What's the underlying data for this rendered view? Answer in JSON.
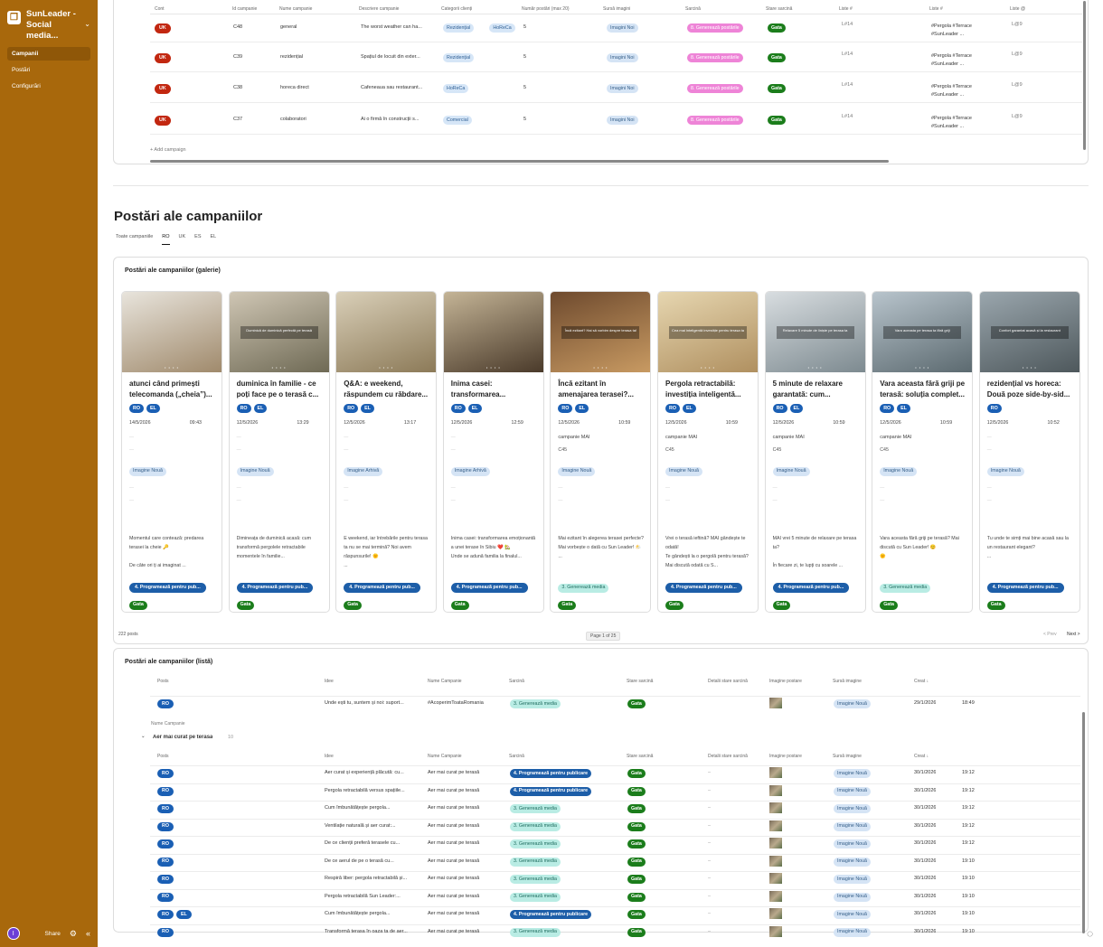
{
  "sidebar": {
    "title": "SunLeader - Social media...",
    "items": [
      {
        "label": "Campanii",
        "active": true
      },
      {
        "label": "Postări",
        "active": false
      },
      {
        "label": "Configurări",
        "active": false
      }
    ],
    "avatar": "I",
    "share": "Share"
  },
  "campaigns_table": {
    "headers": [
      "Cont",
      "Id campanie",
      "Nume campanie",
      "Descriere campanie",
      "Categorii clienți",
      "Număr postări (max 20)",
      "Sursă imagini",
      "Sarcină",
      "Stare sarcină",
      "Liste #",
      "Liste #",
      "Liste @"
    ],
    "rows": [
      {
        "cont": "UK",
        "id": "C48",
        "name": "general",
        "desc": "The worst weather can ha...",
        "cats": [
          "Rezidențial",
          "HoReCa"
        ],
        "count": "5",
        "source": "Imagini Noi",
        "task": "8. Generează postările",
        "state": "Gata",
        "list1": "L#14",
        "tags1": "#Pergola #Terrace",
        "tags2": "#SunLeader ...",
        "list3": "L@9"
      },
      {
        "cont": "UK",
        "id": "C39",
        "name": "rezidențial",
        "desc": "Spațiul de locuit din exter...",
        "cats": [
          "Rezidențial"
        ],
        "count": "5",
        "source": "Imagini Noi",
        "task": "8. Generează postările",
        "state": "Gata",
        "list1": "L#14",
        "tags1": "#Pergola #Terrace",
        "tags2": "#SunLeader ...",
        "list3": "L@9"
      },
      {
        "cont": "UK",
        "id": "C38",
        "name": "horeca direct",
        "desc": "Cafeneaua sau restaurant...",
        "cats": [
          "HoReCa"
        ],
        "count": "5",
        "source": "Imagini Noi",
        "task": "8. Generează postările",
        "state": "Gata",
        "list1": "L#14",
        "tags1": "#Pergola #Terrace",
        "tags2": "#SunLeader ...",
        "list3": "L@9"
      },
      {
        "cont": "UK",
        "id": "C37",
        "name": "colaboratori",
        "desc": "Ai o firmă în construcții s...",
        "cats": [
          "Comercial"
        ],
        "count": "5",
        "source": "Imagini Noi",
        "task": "8. Generează postările",
        "state": "Gata",
        "list1": "L#14",
        "tags1": "#Pergola #Terrace",
        "tags2": "#SunLeader ...",
        "list3": "L@9"
      }
    ],
    "add_label": "+ Add campaign"
  },
  "posts_section": {
    "title": "Postări ale campaniilor",
    "tabs": [
      "Toate campaniile",
      "RO",
      "UK",
      "ES",
      "EL"
    ],
    "active_tab": "RO"
  },
  "gallery": {
    "title": "Postări ale campaniilor (galerie)",
    "cards": [
      {
        "title": "atunci când primești telecomanda („cheia”)...",
        "langs": [
          "RO",
          "EL"
        ],
        "date": "14/5/2026",
        "time": "09:43",
        "campaign": "",
        "cid": "",
        "img": "Imagine Nouă",
        "idea": "Momentul care contează: predarea terasei la cheie 🔑\n\nDe câte ori ți ai imaginat ...",
        "task": "4. Programează pentru pub...",
        "task_kind": "dark",
        "state": "Gata",
        "overlay": "",
        "colors": [
          "#e8e4dc",
          "#a08a6c"
        ]
      },
      {
        "title": "duminica în familie - ce poți face pe o terasă c...",
        "langs": [
          "RO",
          "EL"
        ],
        "date": "12/5/2026",
        "time": "13:29",
        "campaign": "",
        "cid": "",
        "img": "Imagine Nouă",
        "idea": "Dimineața de duminică acasă: cum transformă pergolele retractabile momentele în familie...",
        "task": "4. Programează pentru pub...",
        "task_kind": "dark",
        "state": "Gata",
        "overlay": "Duminică de duminică perfectă pe terasă",
        "colors": [
          "#cfc6b4",
          "#6f6a55"
        ]
      },
      {
        "title": "Q&A: e weekend, răspundem cu răbdare...",
        "langs": [
          "RO",
          "EL"
        ],
        "date": "12/5/2026",
        "time": "13:17",
        "campaign": "",
        "cid": "",
        "img": "Imagine Arhivă",
        "idea": "E weekend, iar întrebările pentru terasa ta nu se mai termină? Noi avem răspunsurile! 🌞\n...",
        "task": "4. Programează pentru pub...",
        "task_kind": "dark",
        "state": "Gata",
        "overlay": "",
        "colors": [
          "#d9cfb8",
          "#8c7a58"
        ]
      },
      {
        "title": "Inima casei: transformarea...",
        "langs": [
          "RO",
          "EL"
        ],
        "date": "12/5/2026",
        "time": "12:59",
        "campaign": "",
        "cid": "",
        "img": "Imagine Arhivă",
        "idea": "Inima casei: transformarea emoționantă a unei terase în Sibiu ❤️ 🏡\nUnde se adună familia la finalul...",
        "task": "4. Programează pentru pub...",
        "task_kind": "dark",
        "state": "Gata",
        "overlay": "",
        "colors": [
          "#c4b496",
          "#4a3a2a"
        ]
      },
      {
        "title": "Încă ezitant în amenajarea terasei?...",
        "langs": [
          "RO",
          "EL"
        ],
        "date": "12/5/2026",
        "time": "10:59",
        "campaign": "campanie MAI",
        "cid": "C45",
        "img": "Imagine Nouă",
        "idea": "Mai ezitant în alegerea terasei perfecte? Mai vorbește o dată cu Sun Leader! 🌤️\n...",
        "task": "3. Generează media",
        "task_kind": "teal",
        "state": "Gata",
        "overlay": "Încă ezitant? Hai să vorbim despre terasa ta!",
        "colors": [
          "#6e4a2e",
          "#c89a62"
        ]
      },
      {
        "title": "Pergola retractabilă: investiția inteligentă...",
        "langs": [
          "RO",
          "EL"
        ],
        "date": "12/5/2026",
        "time": "10:59",
        "campaign": "campanie MAI",
        "cid": "C45",
        "img": "Imagine Nouă",
        "idea": "Vrei o terasă ieftină? MAI gândește te odată!\nTe gândești la o pergolă pentru terasă? Mai discută odată cu S...",
        "task": "4. Programează pentru pub...",
        "task_kind": "dark",
        "state": "Gata",
        "overlay": "Cea mai inteligentă investiție pentru terasa ta",
        "colors": [
          "#e6d6b0",
          "#b09060"
        ]
      },
      {
        "title": "5 minute de relaxare garantată: cum...",
        "langs": [
          "RO",
          "EL"
        ],
        "date": "12/5/2026",
        "time": "10:59",
        "campaign": "campanie MAI",
        "cid": "C45",
        "img": "Imagine Nouă",
        "idea": "MAI vrei 5 minute de relaxare pe terasa ta?\n\nÎn fiecare zi, te lupți cu soarele ...",
        "task": "4. Programează pentru pub...",
        "task_kind": "dark",
        "state": "Gata",
        "overlay": "Relaxare 5 minute de liniște pe terasa ta",
        "colors": [
          "#d8dde0",
          "#7d8a90"
        ]
      },
      {
        "title": "Vara aceasta fără griji pe terasă: soluția complet...",
        "langs": [
          "RO",
          "EL"
        ],
        "date": "12/5/2026",
        "time": "10:59",
        "campaign": "campanie MAI",
        "cid": "C45",
        "img": "Imagine Nouă",
        "idea": "Vara aceasta fără griji pe terasă? Mai discută cu Sun Leader! 😊\n🌞",
        "task": "3. Generează media",
        "task_kind": "teal",
        "state": "Gata",
        "overlay": "Vara aceasta pe terasa ta fără griji",
        "colors": [
          "#b8c4cc",
          "#5c6a70"
        ]
      },
      {
        "title": "rezidențial vs horeca: Două poze side-by-sid...",
        "langs": [
          "RO"
        ],
        "date": "12/5/2026",
        "time": "10:52",
        "campaign": "",
        "cid": "",
        "img": "Imagine Nouă",
        "idea": "Tu unde te simți mai bine acasă sau la un restaurant elegant?\n...",
        "task": "4. Programează pentru pub...",
        "task_kind": "dark",
        "state": "Gata",
        "overlay": "Confort garantat acasă și la restaurant",
        "colors": [
          "#9aa6ad",
          "#4e585c"
        ]
      }
    ],
    "count": "222 posts",
    "page": "Page 1 of 25",
    "prev": "< Prev",
    "next": "Next >"
  },
  "list": {
    "title": "Postări ale campaniilor (listă)",
    "headers": [
      "Posts",
      "Idee",
      "Nume Campanie",
      "Sarcină",
      "Stare sarcină",
      "Detalii stare sarcină",
      "Imagine postare",
      "Sursă imagine",
      "Creat ↓"
    ],
    "top_row": {
      "langs": [
        "RO"
      ],
      "idea": "Unde ești tu, suntem și noi: suport...",
      "campaign": "#AcoperimToataRomania",
      "task": "3. Generează media",
      "task_kind": "teal",
      "state": "Gata",
      "detail": "",
      "img": "Imagine Nouă",
      "date": "29/1/2026",
      "time": "18:49"
    },
    "group_label": "Nume Campanie",
    "group_name": "Aer mai curat pe terasă",
    "group_count": "10",
    "rows": [
      {
        "langs": [
          "RO"
        ],
        "idea": "Aer curat și experiență plăcută: cu...",
        "campaign": "Aer mai curat pe terasă",
        "task": "4. Programează pentru publicare",
        "task_kind": "dark",
        "state": "Gata",
        "detail": "–",
        "img": "Imagine Nouă",
        "date": "30/1/2026",
        "time": "19:12"
      },
      {
        "langs": [
          "RO"
        ],
        "idea": "Pergola retractabilă versus spațiile...",
        "campaign": "Aer mai curat pe terasă",
        "task": "4. Programează pentru publicare",
        "task_kind": "dark",
        "state": "Gata",
        "detail": "–",
        "img": "Imagine Nouă",
        "date": "30/1/2026",
        "time": "19:12"
      },
      {
        "langs": [
          "RO"
        ],
        "idea": "Cum îmbunătățește pergola...",
        "campaign": "Aer mai curat pe terasă",
        "task": "3. Generează media",
        "task_kind": "teal",
        "state": "Gata",
        "detail": "–",
        "img": "Imagine Nouă",
        "date": "30/1/2026",
        "time": "19:12"
      },
      {
        "langs": [
          "RO"
        ],
        "idea": "Ventilație naturală și aer curat:...",
        "campaign": "Aer mai curat pe terasă",
        "task": "3. Generează media",
        "task_kind": "teal",
        "state": "Gata",
        "detail": "–",
        "img": "Imagine Nouă",
        "date": "30/1/2026",
        "time": "19:12"
      },
      {
        "langs": [
          "RO"
        ],
        "idea": "De ce clienții preferă terasele cu...",
        "campaign": "Aer mai curat pe terasă",
        "task": "3. Generează media",
        "task_kind": "teal",
        "state": "Gata",
        "detail": "–",
        "img": "Imagine Nouă",
        "date": "30/1/2026",
        "time": "19:12"
      },
      {
        "langs": [
          "RO"
        ],
        "idea": "De ce aerul de pe o terasă cu...",
        "campaign": "Aer mai curat pe terasă",
        "task": "3. Generează media",
        "task_kind": "teal",
        "state": "Gata",
        "detail": "–",
        "img": "Imagine Nouă",
        "date": "30/1/2026",
        "time": "19:10"
      },
      {
        "langs": [
          "RO"
        ],
        "idea": "Respiră liber: pergola retractabilă și...",
        "campaign": "Aer mai curat pe terasă",
        "task": "3. Generează media",
        "task_kind": "teal",
        "state": "Gata",
        "detail": "–",
        "img": "Imagine Nouă",
        "date": "30/1/2026",
        "time": "19:10"
      },
      {
        "langs": [
          "RO"
        ],
        "idea": "Pergola retractabilă Sun Leader:...",
        "campaign": "Aer mai curat pe terasă",
        "task": "3. Generează media",
        "task_kind": "teal",
        "state": "Gata",
        "detail": "–",
        "img": "Imagine Nouă",
        "date": "30/1/2026",
        "time": "19:10"
      },
      {
        "langs": [
          "RO",
          "EL"
        ],
        "idea": "Cum îmbunătățește pergola...",
        "campaign": "Aer mai curat pe terasă",
        "task": "4. Programează pentru publicare",
        "task_kind": "dark",
        "state": "Gata",
        "detail": "–",
        "img": "Imagine Nouă",
        "date": "30/1/2026",
        "time": "19:10"
      },
      {
        "langs": [
          "RO"
        ],
        "idea": "Transformă terasa în oaza ta de aer...",
        "campaign": "Aer mai curat pe terasă",
        "task": "3. Generează media",
        "task_kind": "teal",
        "state": "Gata",
        "detail": "–",
        "img": "Imagine Nouă",
        "date": "30/1/2026",
        "time": "19:10"
      }
    ]
  }
}
